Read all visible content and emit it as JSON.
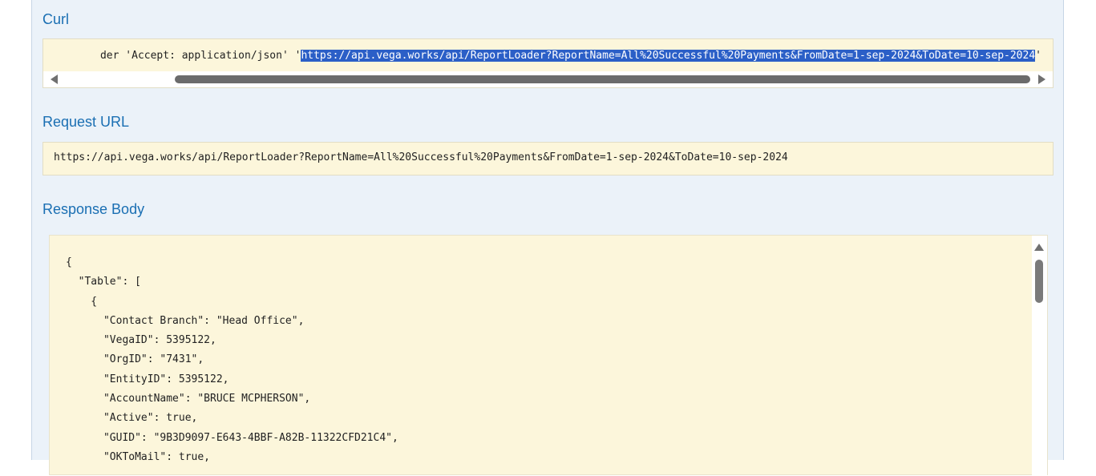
{
  "sections": {
    "curl": {
      "title": "Curl",
      "prefix": "der 'Accept: application/json' '",
      "selected": "https://api.vega.works/api/ReportLoader?ReportName=All%20Successful%20Payments&FromDate=1-sep-2024&ToDate=10-sep-2024",
      "suffix": "'"
    },
    "request_url": {
      "title": "Request URL",
      "value": "https://api.vega.works/api/ReportLoader?ReportName=All%20Successful%20Payments&FromDate=1-sep-2024&ToDate=10-sep-2024"
    },
    "response_body": {
      "title": "Response Body",
      "lines": [
        "{",
        "  \"Table\": [",
        "    {",
        "      \"Contact Branch\": \"Head Office\",",
        "      \"VegaID\": 5395122,",
        "      \"OrgID\": \"7431\",",
        "      \"EntityID\": 5395122,",
        "      \"AccountName\": \"BRUCE MCPHERSON\",",
        "      \"Active\": true,",
        "      \"GUID\": \"9B3D9097-E643-4BBF-A82B-11322CFD21C4\",",
        "      \"OKToMail\": true,"
      ]
    }
  },
  "colors": {
    "panel_background": "#ebf2f9",
    "section_title": "#1a6fb3",
    "code_background": "#fcf6db",
    "selection": "#2b5fc7"
  }
}
